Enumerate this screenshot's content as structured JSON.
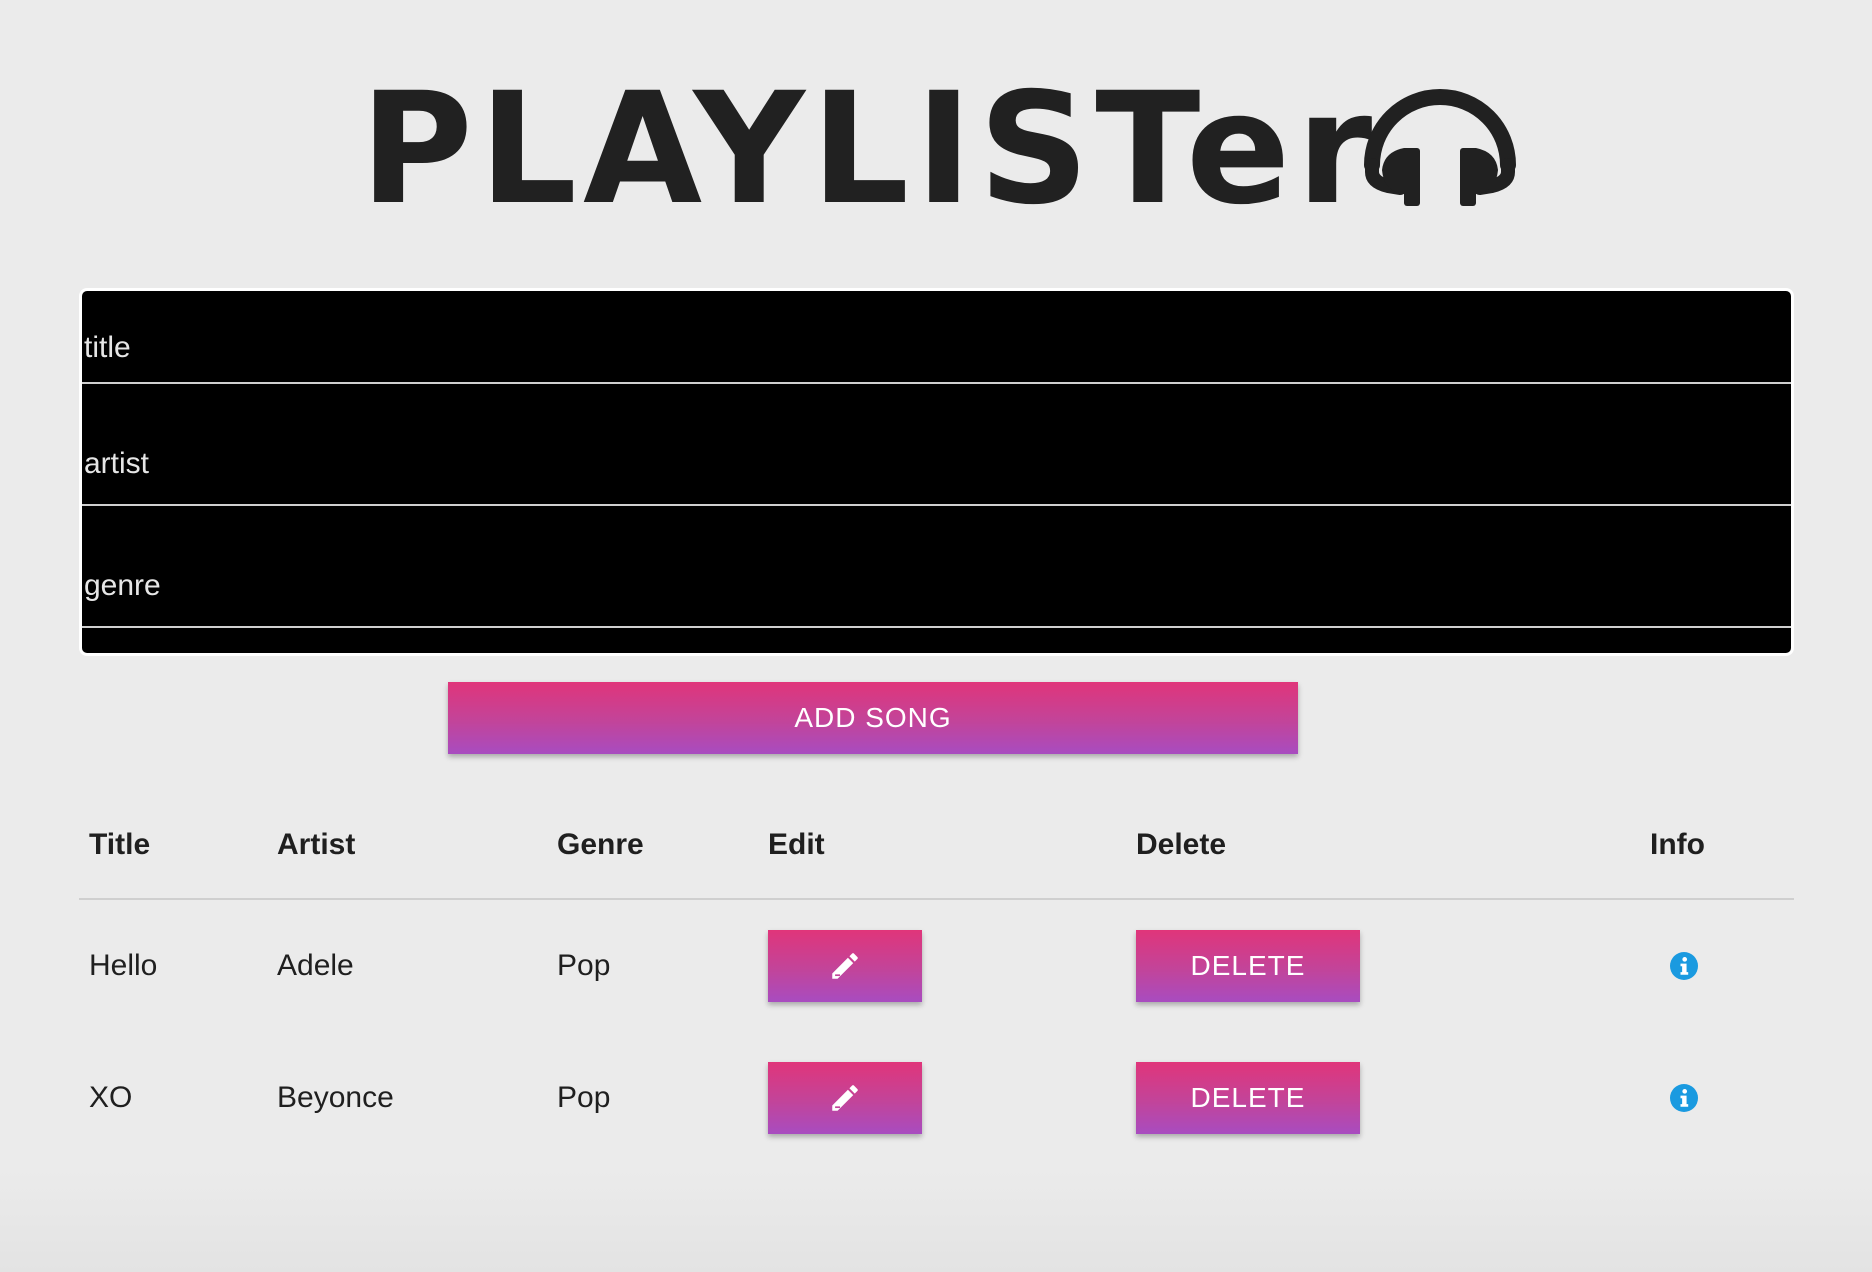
{
  "header": {
    "logo_text": "PLAYLISTer",
    "logo_icon": "headphones-icon"
  },
  "form": {
    "title_placeholder": "title",
    "artist_placeholder": "artist",
    "genre_placeholder": "genre",
    "submit_label": "ADD SONG"
  },
  "table": {
    "headers": {
      "title": "Title",
      "artist": "Artist",
      "genre": "Genre",
      "edit": "Edit",
      "delete": "Delete",
      "info": "Info"
    },
    "rows": [
      {
        "title": "Hello",
        "artist": "Adele",
        "genre": "Pop",
        "edit_icon": "pencil-icon",
        "delete_label": "DELETE",
        "info_icon": "info-icon"
      },
      {
        "title": "XO",
        "artist": "Beyonce",
        "genre": "Pop",
        "edit_icon": "pencil-icon",
        "delete_label": "DELETE",
        "info_icon": "info-icon"
      }
    ]
  },
  "colors": {
    "button_gradient_top": "#e0357a",
    "button_gradient_bottom": "#a84cc0",
    "info_icon": "#1a9ae0",
    "background": "#ebebeb",
    "form_background": "#000000"
  }
}
